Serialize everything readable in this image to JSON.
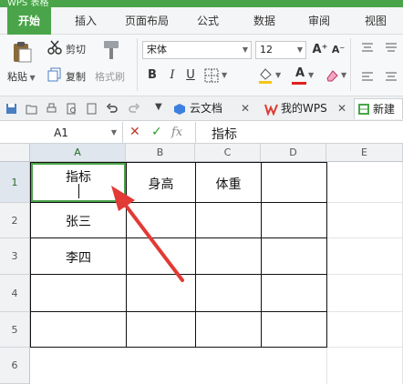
{
  "app": {
    "title": "WPS 表格"
  },
  "menu": {
    "items": [
      {
        "label": "开始",
        "active": true
      },
      {
        "label": "插入"
      },
      {
        "label": "页面布局"
      },
      {
        "label": "公式"
      },
      {
        "label": "数据"
      },
      {
        "label": "审阅"
      },
      {
        "label": "视图"
      }
    ]
  },
  "ribbon": {
    "cut": "剪切",
    "paste": "粘贴",
    "copy": "复制",
    "format_painter": "格式刷",
    "font_name": "宋体",
    "font_size": "12",
    "bold": "B",
    "italic": "I",
    "underline": "U",
    "font_grow": "A⁺",
    "font_shrink": "A⁻",
    "font_color": "A"
  },
  "colors": {
    "accent": "#4aa44a",
    "font_color_bar": "#e02020",
    "fill_bar": "#f5c518",
    "arrow": "#e23a35"
  },
  "quickbar": {
    "tabs": [
      {
        "label": "云文档"
      },
      {
        "label": "我的WPS"
      },
      {
        "label": "新建"
      }
    ]
  },
  "formula": {
    "namebox": "A1",
    "fx": "fx",
    "value": "指标"
  },
  "grid": {
    "columns": [
      "A",
      "B",
      "C",
      "D",
      "E"
    ],
    "rows": [
      "1",
      "2",
      "3",
      "4",
      "5",
      "6"
    ],
    "cells": {
      "a1": "指标",
      "b1": "身高",
      "c1": "体重",
      "a2": "张三",
      "a3": "李四"
    }
  }
}
